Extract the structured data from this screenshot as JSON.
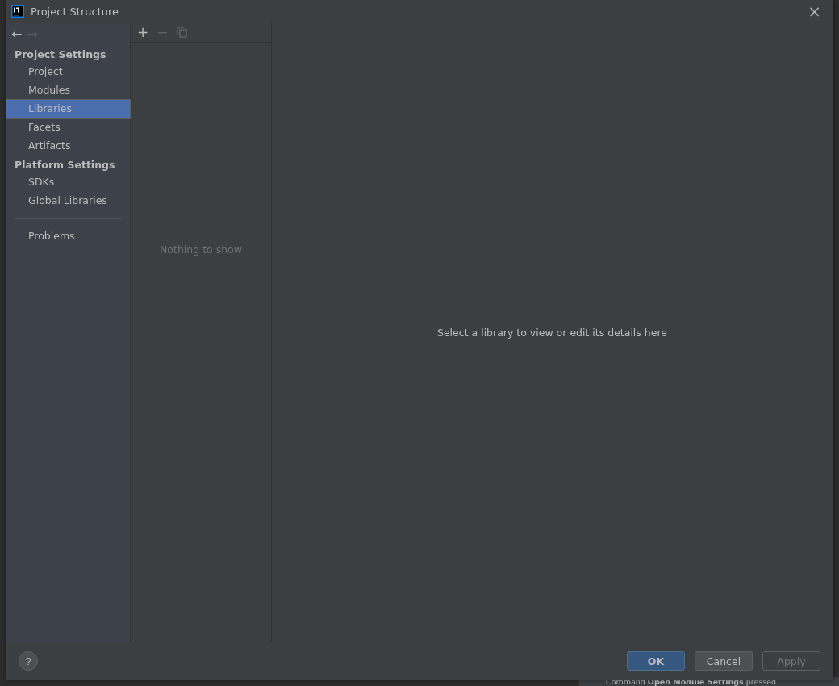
{
  "window": {
    "title": "Project Structure",
    "close": "×"
  },
  "navigation": {
    "back": "←",
    "forward": "→",
    "forward_disabled": true
  },
  "sidebar": {
    "sections": [
      {
        "title": "Project Settings",
        "items": [
          {
            "label": "Project",
            "selected": false
          },
          {
            "label": "Modules",
            "selected": false
          },
          {
            "label": "Libraries",
            "selected": true
          },
          {
            "label": "Facets",
            "selected": false
          },
          {
            "label": "Artifacts",
            "selected": false
          }
        ]
      },
      {
        "title": "Platform Settings",
        "items": [
          {
            "label": "SDKs",
            "selected": false
          },
          {
            "label": "Global Libraries",
            "selected": false
          }
        ]
      }
    ],
    "footer_items": [
      {
        "label": "Problems",
        "selected": false
      }
    ]
  },
  "list_panel": {
    "toolbar": [
      {
        "kind": "add",
        "label": "+",
        "disabled": false
      },
      {
        "kind": "remove",
        "label": "−",
        "disabled": true
      },
      {
        "kind": "copy",
        "disabled": true
      }
    ],
    "empty_text": "Nothing to show"
  },
  "detail_panel": {
    "empty_text": "Select a library to view or edit its details here"
  },
  "buttons": [
    {
      "label": "OK",
      "kind": "default",
      "disabled": false
    },
    {
      "label": "Cancel",
      "kind": "normal",
      "disabled": false
    },
    {
      "label": "Apply",
      "kind": "normal",
      "disabled": true
    }
  ],
  "help": "?",
  "background_notification": "Command **Open Module Settings** pressed…"
}
